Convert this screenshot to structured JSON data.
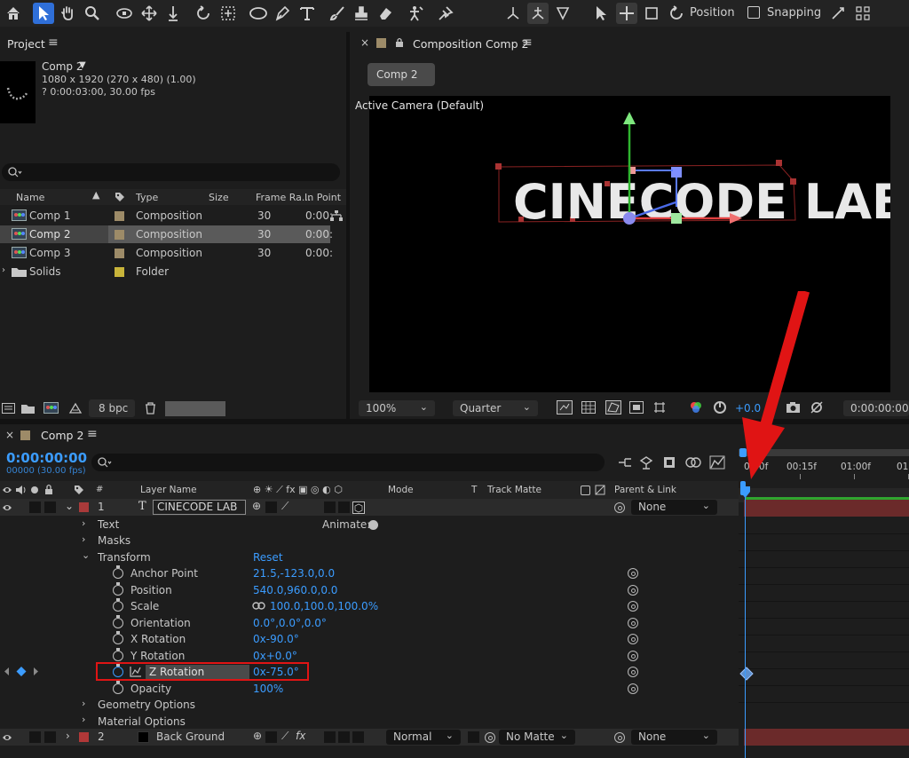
{
  "toolbar": {
    "tools": [
      "home-icon",
      "selection-tool-icon",
      "hand-tool-icon",
      "zoom-tool-icon",
      "orbit-camera-icon",
      "pan-camera-icon",
      "dolly-camera-icon",
      "rotate-tool-icon",
      "pan-behind-icon",
      "ellipse-tool-icon",
      "pen-tool-icon",
      "type-tool-icon",
      "brush-tool-icon",
      "clone-stamp-icon",
      "eraser-icon",
      "roto-brush-icon",
      "puppet-pin-icon",
      "local-axis-icon",
      "world-axis-icon",
      "view-axis-icon",
      "select-cursor-icon",
      "move-icon",
      "bounding-box-icon",
      "rotation-icon"
    ],
    "position_label": "Position",
    "snapping_label": "Snapping"
  },
  "project": {
    "title": "Project",
    "comp_name": "Comp 2",
    "comp_info_1": "1080 x 1920  (270 x 480) (1.00)",
    "comp_info_2": "? 0:00:03:00, 30.00 fps",
    "columns": {
      "name": "Name",
      "type": "Type",
      "size": "Size",
      "frame_rate": "Frame Ra...",
      "in_point": "In Point"
    },
    "items": [
      {
        "name": "Comp 1",
        "type": "Composition",
        "fps": "30",
        "in": "0:00:",
        "color": "#9d8b68"
      },
      {
        "name": "Comp 2",
        "type": "Composition",
        "fps": "30",
        "in": "0:00:",
        "color": "#9d8b68"
      },
      {
        "name": "Comp 3",
        "type": "Composition",
        "fps": "30",
        "in": "0:00:",
        "color": "#9d8b68"
      },
      {
        "name": "Solids",
        "type": "Folder",
        "fps": "",
        "in": "",
        "color": "#c8b43a"
      }
    ],
    "bpc": "8 bpc"
  },
  "viewer": {
    "tab_title": "Composition Comp 2",
    "comp_button": "Comp 2",
    "camera_label": "Active Camera (Default)",
    "logo_text": "CINECODE LAB",
    "zoom": "100%",
    "resolution": "Quarter",
    "exposure": "+0.0",
    "timecode": "0:00:00:00"
  },
  "timeline": {
    "tab_title": "Comp 2",
    "current_time": "0:00:00:00",
    "frame_info": "00000 (30.00 fps)",
    "col_num": "#",
    "col_layer_name": "Layer Name",
    "col_mode": "Mode",
    "col_t": "T",
    "col_track_matte": "Track Matte",
    "col_parent": "Parent & Link",
    "ruler": [
      "0:00f",
      "00:15f",
      "01:00f",
      "01:"
    ],
    "layer1": {
      "num": "1",
      "name": "CINECODE LAB",
      "parent": "None"
    },
    "text_group": "Text",
    "animate_label": "Animate:",
    "masks": "Masks",
    "transform": "Transform",
    "reset": "Reset",
    "properties": [
      {
        "name": "Anchor Point",
        "value": "21.5,-123.0,0.0"
      },
      {
        "name": "Position",
        "value": "540.0,960.0,0.0"
      },
      {
        "name": "Scale",
        "value": "100.0,100.0,100.0%"
      },
      {
        "name": "Orientation",
        "value": "0.0°,0.0°,0.0°"
      },
      {
        "name": "X Rotation",
        "value": "0x-90.0°"
      },
      {
        "name": "Y Rotation",
        "value": "0x+0.0°"
      },
      {
        "name": "Z Rotation",
        "value": "0x-75.0°"
      },
      {
        "name": "Opacity",
        "value": "100%"
      }
    ],
    "geometry_options": "Geometry Options",
    "material_options": "Material Options",
    "layer2": {
      "num": "2",
      "name": "Back Ground",
      "mode": "Normal",
      "matte": "No Matte",
      "parent": "None"
    }
  },
  "colors": {
    "accent": "#3b9cff",
    "highlight": "#e01414",
    "layer1_label": "#a93a3a",
    "layer2_label": "#b13838"
  }
}
